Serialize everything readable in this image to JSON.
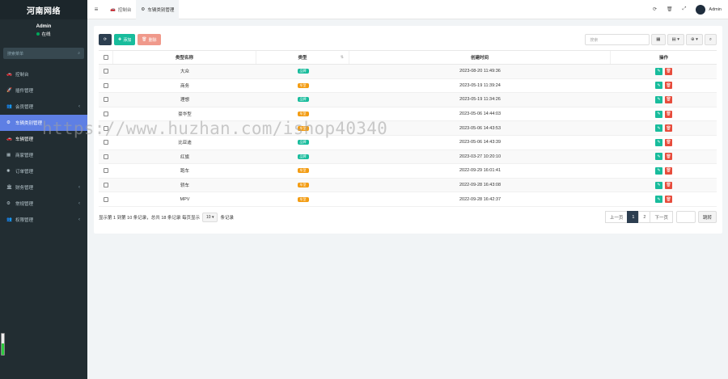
{
  "colors": {
    "sidebar_bg": "#222d32",
    "accent_active": "#5e7fe4",
    "success": "#18bc9c",
    "danger": "#e74c3c",
    "warning": "#f39c12",
    "dark": "#2c3e50"
  },
  "sidebar": {
    "logo": "河南网络",
    "user_name": "Admin",
    "user_status": "在线",
    "search_placeholder": "搜索菜单",
    "items": [
      {
        "label": "控制台",
        "icon": "car-icon"
      },
      {
        "label": "插件管理",
        "icon": "rocket-icon"
      },
      {
        "label": "会员管理",
        "icon": "users-icon",
        "arrow": "‹"
      },
      {
        "label": "车辆类别管理",
        "icon": "gear-icon",
        "active": true
      },
      {
        "label": "车辆管理",
        "icon": "car-icon"
      },
      {
        "label": "商家管理",
        "icon": "store-icon"
      },
      {
        "label": "订单管理",
        "icon": "order-icon"
      },
      {
        "label": "财务管理",
        "icon": "bank-icon",
        "arrow": "‹"
      },
      {
        "label": "常规管理",
        "icon": "cogs-icon",
        "arrow": "‹"
      },
      {
        "label": "权限管理",
        "icon": "group-icon",
        "arrow": "‹"
      }
    ]
  },
  "header": {
    "tabs": [
      {
        "label": "控制台",
        "icon": "car-icon"
      },
      {
        "label": "车辆类别管理",
        "icon": "gear-icon",
        "active": true
      }
    ],
    "admin_name": "Admin"
  },
  "toolbar": {
    "add_label": "添加",
    "delete_label": "删除",
    "search_placeholder": "搜索"
  },
  "table": {
    "headers": [
      "类型名称",
      "类型",
      "创建时间",
      "操作"
    ],
    "rows": [
      {
        "name": "大众",
        "type": "品牌",
        "type_color": "#18bc9c",
        "time": "2023-08-20 11:49:36"
      },
      {
        "name": "商务",
        "type": "车型",
        "type_color": "#f39c12",
        "time": "2023-05-19 11:39:24"
      },
      {
        "name": "理想",
        "type": "品牌",
        "type_color": "#18bc9c",
        "time": "2023-05-19 11:34:26"
      },
      {
        "name": "豪华型",
        "type": "车型",
        "type_color": "#f39c12",
        "time": "2023-05-06 14:44:03"
      },
      {
        "name": "",
        "type": "车型",
        "type_color": "#f39c12",
        "time": "2023-05-06 14:43:53"
      },
      {
        "name": "比亚迪",
        "type": "品牌",
        "type_color": "#18bc9c",
        "time": "2023-05-06 14:43:39"
      },
      {
        "name": "红旗",
        "type": "品牌",
        "type_color": "#18bc9c",
        "time": "2023-03-27 10:20:10"
      },
      {
        "name": "跑车",
        "type": "车型",
        "type_color": "#f39c12",
        "time": "2022-09-29 16:01:41"
      },
      {
        "name": "轿车",
        "type": "车型",
        "type_color": "#f39c12",
        "time": "2022-09-28 16:43:08"
      },
      {
        "name": "MPV",
        "type": "车型",
        "type_color": "#f39c12",
        "time": "2022-09-28 16:42:37"
      }
    ]
  },
  "footer": {
    "info_prefix": "显示第 1 到第 10 条记录，总共 18 条记录 每页显示",
    "page_size": "10",
    "info_suffix": "条记录",
    "prev": "上一页",
    "pages": [
      "1",
      "2"
    ],
    "next": "下一页",
    "jump": "跳转"
  },
  "watermark": "https://www.huzhan.com/ishop40340"
}
